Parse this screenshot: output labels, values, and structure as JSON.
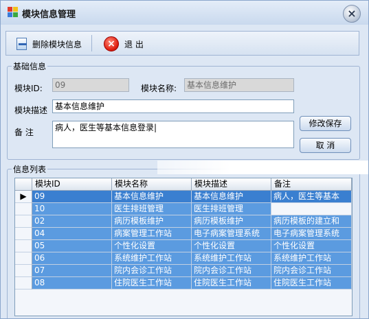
{
  "window": {
    "title": "模块信息管理",
    "close_icon": "close-icon"
  },
  "toolbar": {
    "delete_label": "删除模块信息",
    "delete_icon": "delete-document-icon",
    "exit_label": "退 出",
    "exit_icon": "exit-icon"
  },
  "basic_info": {
    "legend": "基础信息",
    "module_id_label": "模块ID:",
    "module_id_value": "09",
    "module_name_label": "模块名称:",
    "module_name_value": "基本信息维护",
    "module_desc_label": "模块描述",
    "module_desc_value": "基本信息维护",
    "note_label": "备 注",
    "note_value": "病人，医生等基本信息登录|",
    "save_button": "修改保存",
    "cancel_button": "取 消"
  },
  "info_list": {
    "legend": "信息列表",
    "columns": [
      "模块ID",
      "模块名称",
      "模块描述",
      "备注"
    ],
    "selected_row_marker": "▶",
    "rows": [
      [
        "09",
        "基本信息维护",
        "基本信息维护",
        "病人，医生等基本"
      ],
      [
        "10",
        "医生排班管理",
        "医生排班管理",
        ""
      ],
      [
        "02",
        "病历模板维护",
        "病历模板维护",
        "病历模板的建立和"
      ],
      [
        "04",
        "病案管理工作站",
        "电子病案管理系统",
        "电子病案管理系统"
      ],
      [
        "05",
        "个性化设置",
        "个性化设置",
        "个性化设置"
      ],
      [
        "06",
        "系统维护工作站",
        "系统维护工作站",
        "系统维护工作站"
      ],
      [
        "07",
        "院内会诊工作站",
        "院内会诊工作站",
        "院内会诊工作站"
      ],
      [
        "08",
        "住院医生工作站",
        "住院医生工作站",
        "住院医生工作站"
      ]
    ]
  },
  "colors": {
    "window_bg": "#dde7f4",
    "row_bg": "#5b9be0",
    "selected_row_bg": "#3a7fd0"
  }
}
